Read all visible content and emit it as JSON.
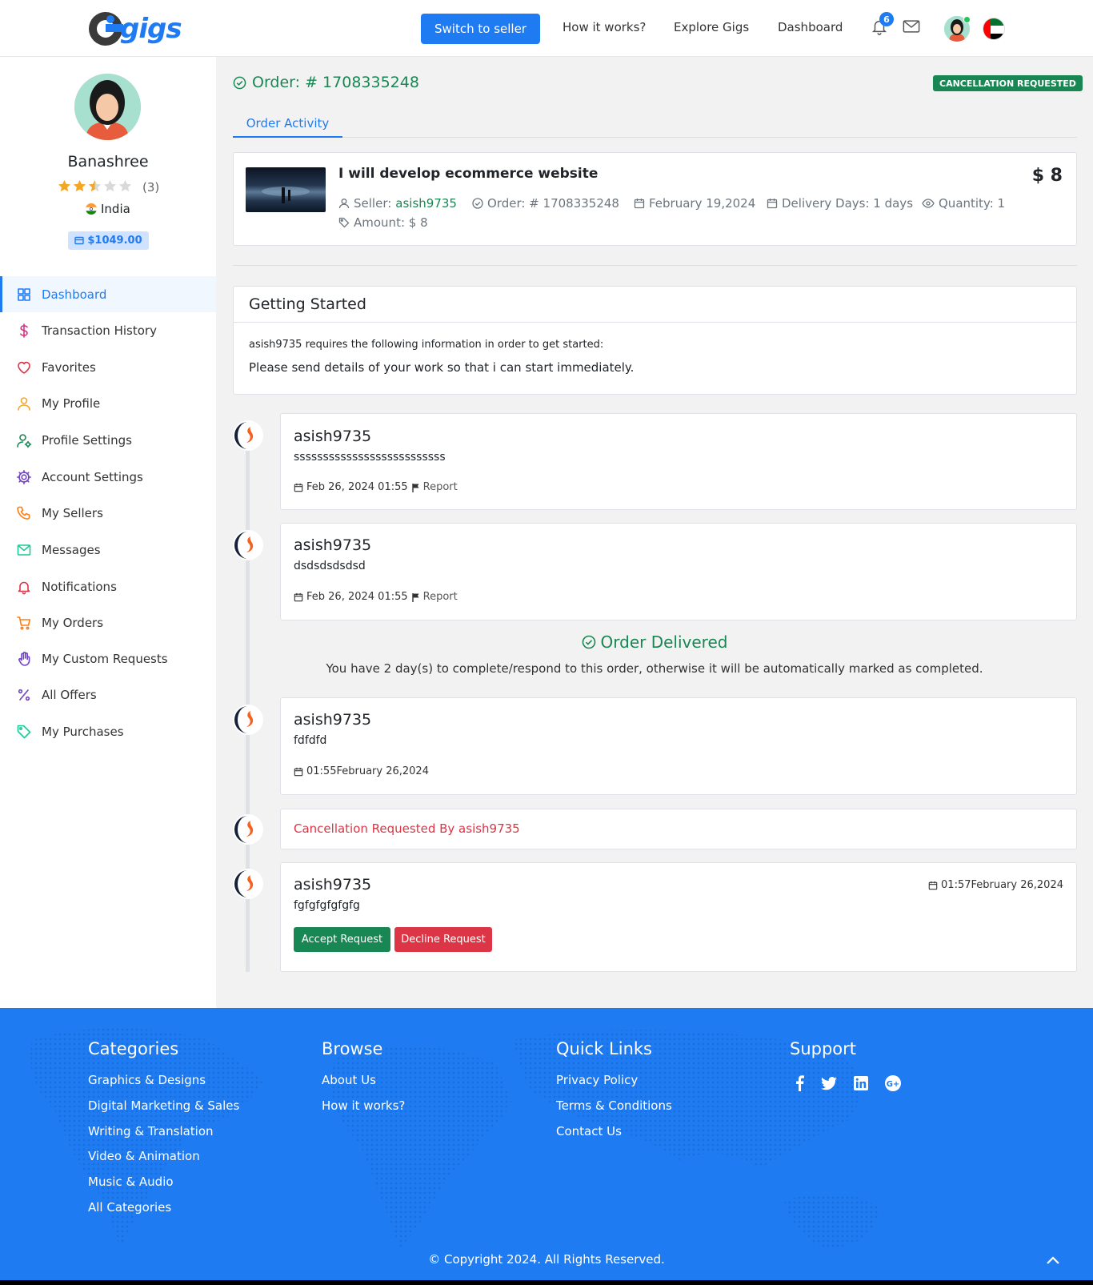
{
  "header": {
    "logo_text": "gigs",
    "switch_label": "Switch to seller",
    "nav": [
      "How it works?",
      "Explore Gigs",
      "Dashboard"
    ],
    "notification_count": "6"
  },
  "sidebar": {
    "name": "Banashree",
    "rating": 2.5,
    "reviews": "(3)",
    "country": "India",
    "balance": "$1049.00",
    "items": [
      {
        "label": "Dashboard",
        "icon": "grid-icon",
        "color": "#1e7bf2"
      },
      {
        "label": "Transaction History",
        "icon": "dollar-icon",
        "color": "#d63384"
      },
      {
        "label": "Favorites",
        "icon": "heart-icon",
        "color": "#dc3545"
      },
      {
        "label": "My Profile",
        "icon": "user-icon",
        "color": "#f5a623"
      },
      {
        "label": "Profile Settings",
        "icon": "user-gear-icon",
        "color": "#198754"
      },
      {
        "label": "Account Settings",
        "icon": "gear-icon",
        "color": "#6f42c1"
      },
      {
        "label": "My Sellers",
        "icon": "phone-icon",
        "color": "#fd7e14"
      },
      {
        "label": "Messages",
        "icon": "mail-icon",
        "color": "#20c997"
      },
      {
        "label": "Notifications",
        "icon": "bell-icon",
        "color": "#dc3545"
      },
      {
        "label": "My Orders",
        "icon": "cart-icon",
        "color": "#fd7e14"
      },
      {
        "label": "My Custom Requests",
        "icon": "hand-icon",
        "color": "#6f42c1"
      },
      {
        "label": "All Offers",
        "icon": "percent-icon",
        "color": "#6f42c1"
      },
      {
        "label": "My Purchases",
        "icon": "tag-icon",
        "color": "#20c997"
      }
    ]
  },
  "order": {
    "title": "Order: # 1708335248",
    "status": "CANCELLATION REQUESTED",
    "tab": "Order Activity",
    "gig": {
      "title": "I will develop ecommerce website",
      "price": "$ 8",
      "seller_label": "Seller:",
      "seller": "asish9735",
      "order_no": "Order: # 1708335248",
      "date": "February 19,2024",
      "delivery": "Delivery Days: 1 days",
      "quantity": "Quantity: 1",
      "amount": "Amount: $ 8"
    }
  },
  "getting_started": {
    "title": "Getting Started",
    "requirement": "asish9735 requires the following information in order to get started:",
    "answer": "Please send details of your work so that i can start immediately."
  },
  "messages": [
    {
      "user": "asish9735",
      "text": "ssssssssssssssssssssssssss",
      "date": "Feb 26, 2024 01:55",
      "report": "Report"
    },
    {
      "user": "asish9735",
      "text": "dsdsdsdsdsd",
      "date": "Feb 26, 2024 01:55",
      "report": "Report"
    },
    {
      "user": "asish9735",
      "text": "fdfdfd",
      "date": "01:55February 26,2024"
    },
    {
      "user": "asish9735",
      "text": "fgfgfgfgfgfg",
      "date": "01:57February 26,2024"
    }
  ],
  "delivered": {
    "title": "Order Delivered",
    "note": "You have 2 day(s) to complete/respond to this order, otherwise it will be automatically marked as completed."
  },
  "cancellation": {
    "text": "Cancellation Requested By asish9735",
    "accept": "Accept Request",
    "decline": "Decline Request"
  },
  "footer": {
    "columns": [
      {
        "title": "Categories",
        "links": [
          "Graphics & Designs",
          "Digital Marketing & Sales",
          "Writing & Translation",
          "Video & Animation",
          "Music & Audio",
          "All Categories"
        ]
      },
      {
        "title": "Browse",
        "links": [
          "About Us",
          "How it works?"
        ]
      },
      {
        "title": "Quick Links",
        "links": [
          "Privacy Policy",
          "Terms & Conditions",
          "Contact Us"
        ]
      },
      {
        "title": "Support",
        "links": []
      }
    ],
    "social": [
      "facebook-icon",
      "twitter-icon",
      "linkedin-icon",
      "google-plus-icon"
    ],
    "copyright": "© Copyright 2024. All Rights Reserved."
  },
  "colors": {
    "brand": "#1e7bf2",
    "success": "#198754",
    "danger": "#dc3545"
  }
}
